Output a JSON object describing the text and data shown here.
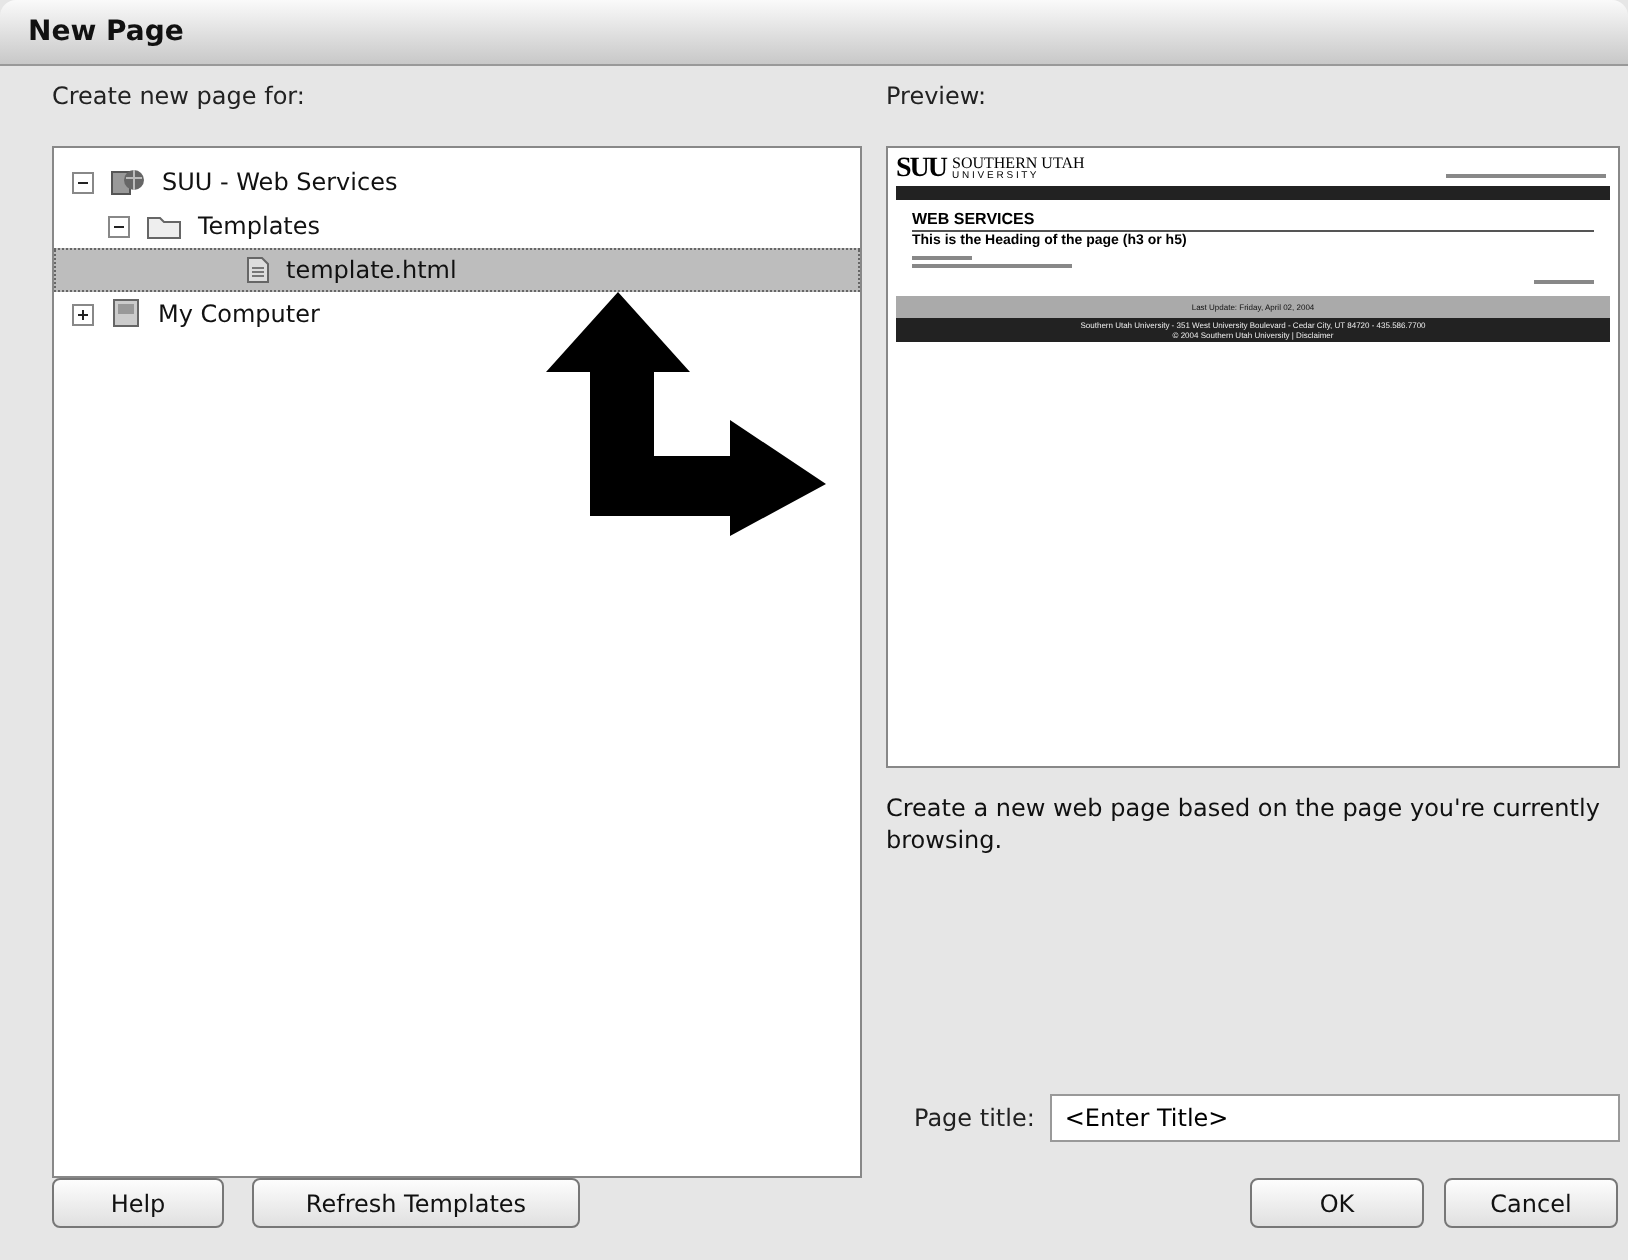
{
  "window": {
    "title": "New Page"
  },
  "tree_label": "Create new page for:",
  "tree": [
    {
      "label": "SUU - Web Services",
      "kind": "site",
      "expanded": true,
      "selected": false,
      "children": [
        {
          "label": "Templates",
          "kind": "folder",
          "expanded": true,
          "selected": false,
          "children": [
            {
              "label": "template.html",
              "kind": "file",
              "selected": true
            }
          ]
        }
      ]
    },
    {
      "label": "My Computer",
      "kind": "computer",
      "expanded": false,
      "selected": false
    }
  ],
  "preview": {
    "label": "Preview:",
    "logo": "SUU",
    "logo_name": "SOUTHERN UTAH",
    "logo_sub": "U N I V E R S I T Y",
    "section": "WEB SERVICES",
    "heading": "This is the Heading of the page (h3 or h5)",
    "updated": "Last Update: Friday, April 02, 2004",
    "footer_lines": [
      "Southern Utah University - 351 West University Boulevard - Cedar City, UT 84720 - 435.586.7700",
      "© 2004 Southern Utah University | Disclaimer"
    ]
  },
  "description": "Create a new web page based on the page you're currently browsing.",
  "page_title": {
    "label": "Page title:",
    "value": "<Enter Title>"
  },
  "buttons_left": [
    "Help",
    "Refresh Templates"
  ],
  "buttons_right": [
    "OK",
    "Cancel"
  ]
}
